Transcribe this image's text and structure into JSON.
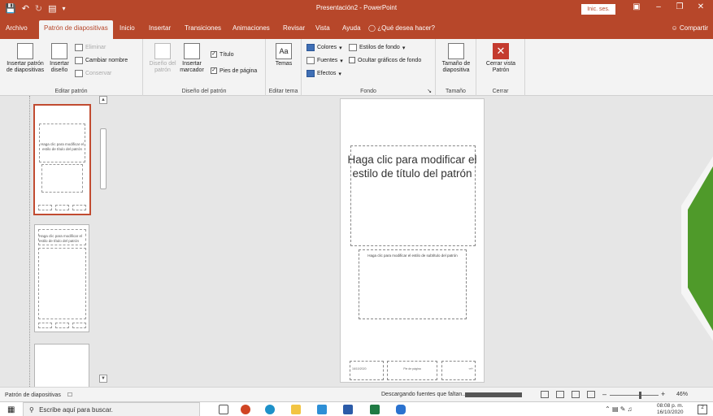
{
  "titlebar": {
    "document_title": "Presentación2  -  PowerPoint",
    "signin_label": "Inic. ses.",
    "qat_icons": [
      "save-icon",
      "undo-icon",
      "redo-icon",
      "start-presentation-icon",
      "customize-qat-icon"
    ]
  },
  "tabs": [
    {
      "label": "Archivo"
    },
    {
      "label": "Patrón de diapositivas",
      "active": true
    },
    {
      "label": "Inicio"
    },
    {
      "label": "Insertar"
    },
    {
      "label": "Transiciones"
    },
    {
      "label": "Animaciones"
    },
    {
      "label": "Revisar"
    },
    {
      "label": "Vista"
    },
    {
      "label": "Ayuda"
    }
  ],
  "tellme_label": "¿Qué desea hacer?",
  "share_label": "Compartir",
  "ribbon": {
    "editar_patron": {
      "group_label": "Editar patrón",
      "insertar_patron": "Insertar patrón de diapositivas",
      "insertar_diseno": "Insertar diseño",
      "eliminar": "Eliminar",
      "cambiar_nombre": "Cambiar nombre",
      "conservar": "Conservar"
    },
    "diseno_patron": {
      "group_label": "Diseño del patrón",
      "diseno_del_patron": "Diseño del patrón",
      "insertar_marcador": "Insertar marcador",
      "titulo": "Título",
      "pies_de_pagina": "Pies de página",
      "titulo_checked": true,
      "pies_checked": true
    },
    "editar_tema": {
      "group_label": "Editar tema",
      "temas": "Temas"
    },
    "fondo": {
      "group_label": "Fondo",
      "colores": "Colores",
      "fuentes": "Fuentes",
      "efectos": "Efectos",
      "estilos_fondo": "Estilos de fondo",
      "ocultar_graficos": "Ocultar gráficos de fondo",
      "ocultar_checked": false
    },
    "tamano": {
      "group_label": "Tamaño",
      "tamano_diapositiva": "Tamaño de diapositiva"
    },
    "cerrar": {
      "group_label": "Cerrar",
      "cerrar_vista": "Cerrar vista Patrón"
    }
  },
  "thumbnails": [
    {
      "title": "Haga clic para modificar el estilo de título del patrón",
      "selected": true
    },
    {
      "title": "Haga clic para modificar el estilo de título del patrón",
      "selected": false
    },
    {
      "title": "",
      "selected": false
    }
  ],
  "slide": {
    "title": "Haga clic para modificar el estilo de título del patrón",
    "subtitle": "Haga clic para modificar el estilo de subtítulo del patrón",
    "footer_left": "16/10/2020",
    "footer_center": "Pie de página",
    "footer_right": "‹nº›"
  },
  "statusbar": {
    "view_label": "Patrón de diapositivas",
    "loading_text": "Descargando fuentes que faltan...",
    "zoom": "46%"
  },
  "taskbar": {
    "search_placeholder": "Escribe aquí para buscar.",
    "time": "08:08 p. m.",
    "date": "16/10/2020"
  },
  "colors": {
    "accent": "#b7472a",
    "ribbon_bg": "#f3f3f3",
    "workspace_bg": "#e6e6e6",
    "deco_green": "#4f9a2a"
  }
}
